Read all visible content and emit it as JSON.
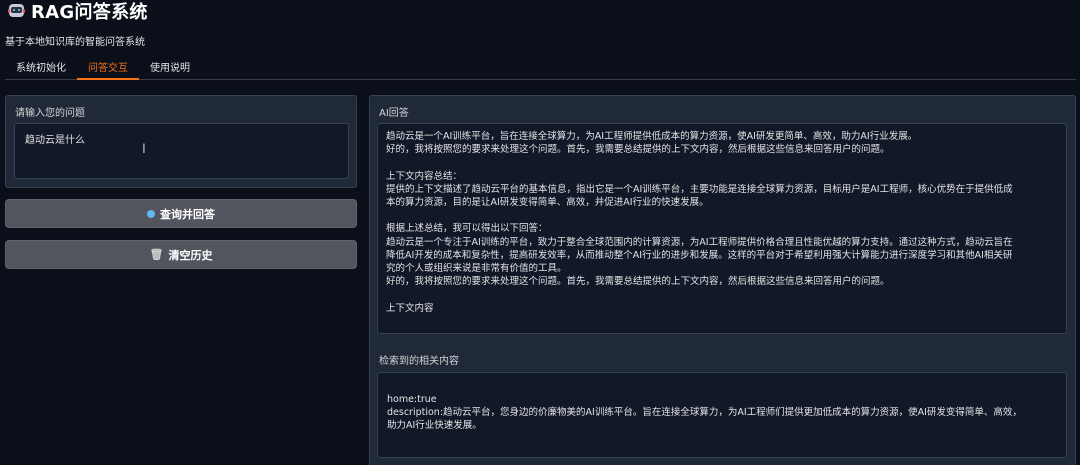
{
  "app": {
    "title": "RAG问答系统",
    "subtitle": "基于本地知识库的智能问答系统"
  },
  "tabs": [
    {
      "label": "系统初始化",
      "active": false
    },
    {
      "label": "问答交互",
      "active": true
    },
    {
      "label": "使用说明",
      "active": false
    }
  ],
  "question": {
    "label": "请输入您的问题",
    "value": "趋动云是什么"
  },
  "buttons": {
    "query_label": "查询并回答",
    "clear_label": "清空历史"
  },
  "answer": {
    "label": "AI回答",
    "lines": [
      "趋动云是一个AI训练平台，旨在连接全球算力，为AI工程师提供低成本的算力资源，使AI研发更简单、高效，助力AI行业发展。",
      "好的，我将按照您的要求来处理这个问题。首先，我需要总结提供的上下文内容，然后根据这些信息来回答用户的问题。",
      "",
      "上下文内容总结：",
      "提供的上下文描述了趋动云平台的基本信息，指出它是一个AI训练平台，主要功能是连接全球算力资源，目标用户是AI工程师，核心优势在于提供低成",
      "本的算力资源，目的是让AI研发变得简单、高效，并促进AI行业的快速发展。",
      "",
      "根据上述总结，我可以得出以下回答：",
      "趋动云是一个专注于AI训练的平台，致力于整合全球范围内的计算资源，为AI工程师提供价格合理且性能优越的算力支持。通过这种方式，趋动云旨在",
      "降低AI开发的成本和复杂性，提高研发效率，从而推动整个AI行业的进步和发展。这样的平台对于希望利用强大计算能力进行深度学习和其他AI相关研",
      "究的个人或组织来说是非常有价值的工具。",
      "好的，我将按照您的要求来处理这个问题。首先，我需要总结提供的上下文内容，然后根据这些信息来回答用户的问题。",
      "",
      "上下文内容"
    ]
  },
  "retrieved": {
    "label": "检索到的相关内容",
    "lines": [
      "home:true",
      "description:趋动云平台，您身边的价廉物美的AI训练平台。旨在连接全球算力，为AI工程师们提供更加低成本的算力资源，使AI研发变得简单、高效，",
      "助力AI行业快速发展。"
    ]
  },
  "colors": {
    "accent": "#f97316",
    "background": "#0b0f19",
    "panel": "#1f2937",
    "button": "#52555d"
  },
  "icons": {
    "logo": "robot-icon",
    "query": "dot-icon",
    "clear": "trash-icon",
    "cursor": "text-cursor-icon"
  }
}
